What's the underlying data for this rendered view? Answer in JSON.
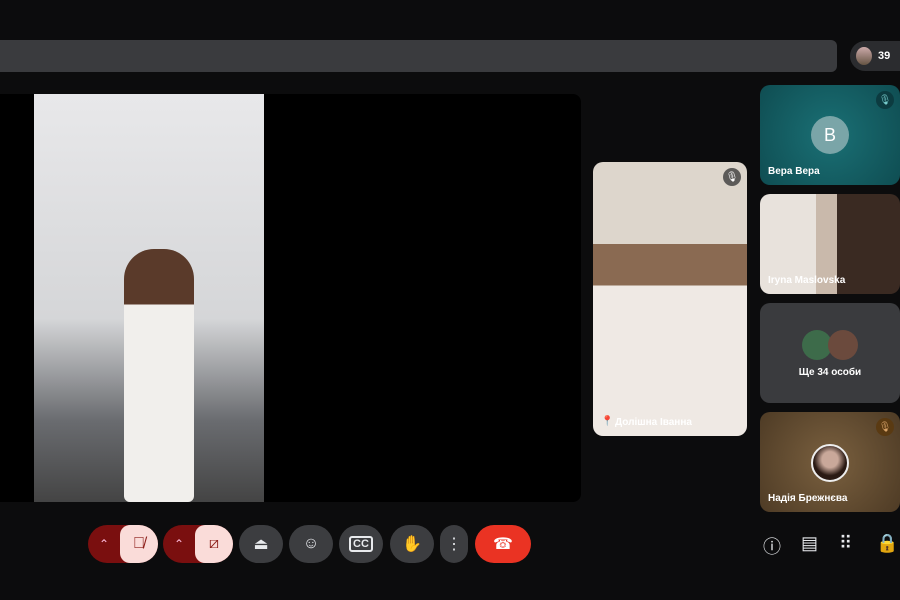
{
  "header": {
    "participant_count": "39"
  },
  "tiles": [
    {
      "name": "Вера Вера",
      "initial": "B",
      "muted": true,
      "color": "#11585e"
    },
    {
      "name": "Iryna Maslovska",
      "muted": false
    },
    {
      "name": "Ще 34 особи"
    },
    {
      "name": "Надія Брежнєва",
      "muted": true,
      "color": "#6b5236"
    },
    {
      "name": "Долішна Іванна",
      "muted": true,
      "pinned": true
    }
  ],
  "controls": {
    "mic": "muted",
    "camera": "off"
  },
  "icons": {
    "mic_off": "mic-off-icon",
    "cam_off": "camera-off-icon",
    "present": "present-icon",
    "emoji": "emoji-icon",
    "captions": "captions-icon",
    "hand": "raise-hand-icon",
    "more": "more-icon",
    "hangup": "hangup-icon",
    "info": "info-icon",
    "chat": "chat-icon",
    "activities": "apps-icon",
    "host": "host-controls-icon"
  }
}
